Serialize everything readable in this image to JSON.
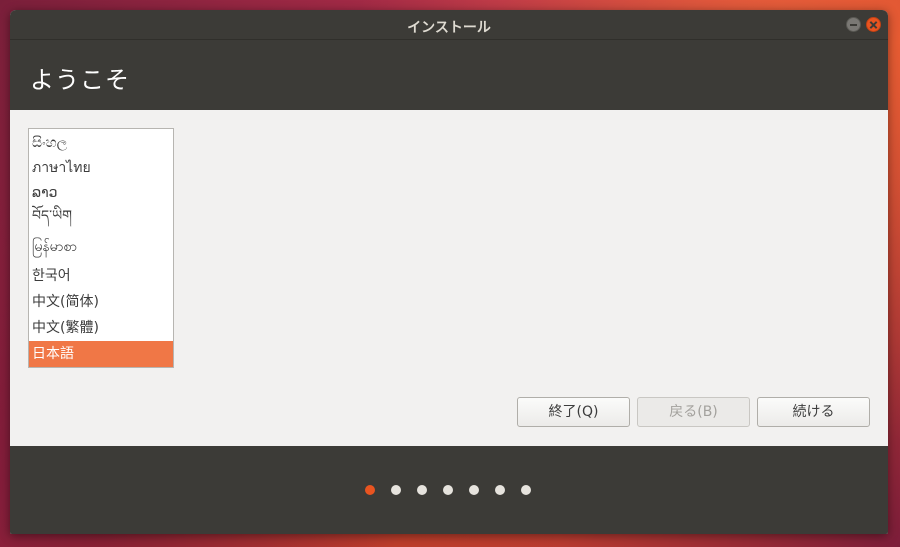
{
  "window": {
    "title": "インストール"
  },
  "header": {
    "heading": "ようこそ"
  },
  "language_list": {
    "items": [
      {
        "label": "සිංහල"
      },
      {
        "label": "ภาษาไทย"
      },
      {
        "label": "ລາວ"
      },
      {
        "label": "བོད་ཡིག"
      },
      {
        "label": "မြန်မာစာ"
      },
      {
        "label": "한국어"
      },
      {
        "label": "中文(简体)"
      },
      {
        "label": "中文(繁體)"
      },
      {
        "label": "日本語"
      }
    ],
    "selected_index": 8
  },
  "buttons": {
    "quit_label": "終了(Q)",
    "back_label": "戻る(B)",
    "continue_label": "続ける"
  },
  "progress": {
    "total_steps": 7,
    "current_step": 1
  },
  "colors": {
    "accent": "#e95420",
    "selection": "#f07746",
    "header_bg": "#3c3b37",
    "content_bg": "#f2f1f0"
  }
}
